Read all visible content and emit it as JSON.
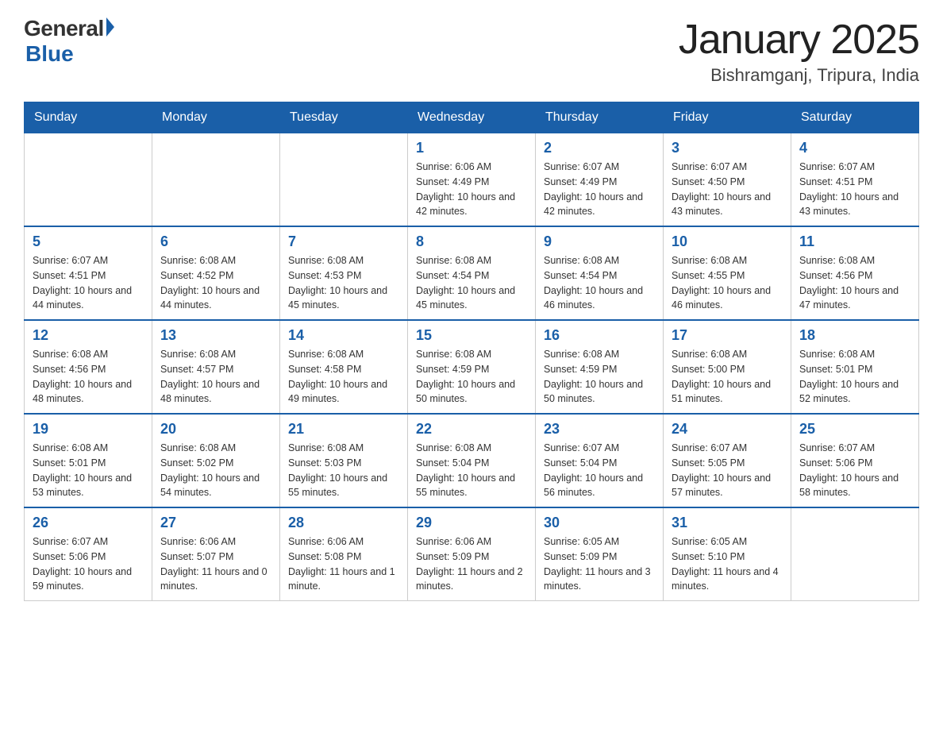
{
  "logo": {
    "general": "General",
    "blue": "Blue",
    "tagline": "Blue"
  },
  "title": {
    "month": "January 2025",
    "location": "Bishramganj, Tripura, India"
  },
  "days_of_week": [
    "Sunday",
    "Monday",
    "Tuesday",
    "Wednesday",
    "Thursday",
    "Friday",
    "Saturday"
  ],
  "weeks": [
    [
      {
        "day": "",
        "sunrise": "",
        "sunset": "",
        "daylight": ""
      },
      {
        "day": "",
        "sunrise": "",
        "sunset": "",
        "daylight": ""
      },
      {
        "day": "",
        "sunrise": "",
        "sunset": "",
        "daylight": ""
      },
      {
        "day": "1",
        "sunrise": "Sunrise: 6:06 AM",
        "sunset": "Sunset: 4:49 PM",
        "daylight": "Daylight: 10 hours and 42 minutes."
      },
      {
        "day": "2",
        "sunrise": "Sunrise: 6:07 AM",
        "sunset": "Sunset: 4:49 PM",
        "daylight": "Daylight: 10 hours and 42 minutes."
      },
      {
        "day": "3",
        "sunrise": "Sunrise: 6:07 AM",
        "sunset": "Sunset: 4:50 PM",
        "daylight": "Daylight: 10 hours and 43 minutes."
      },
      {
        "day": "4",
        "sunrise": "Sunrise: 6:07 AM",
        "sunset": "Sunset: 4:51 PM",
        "daylight": "Daylight: 10 hours and 43 minutes."
      }
    ],
    [
      {
        "day": "5",
        "sunrise": "Sunrise: 6:07 AM",
        "sunset": "Sunset: 4:51 PM",
        "daylight": "Daylight: 10 hours and 44 minutes."
      },
      {
        "day": "6",
        "sunrise": "Sunrise: 6:08 AM",
        "sunset": "Sunset: 4:52 PM",
        "daylight": "Daylight: 10 hours and 44 minutes."
      },
      {
        "day": "7",
        "sunrise": "Sunrise: 6:08 AM",
        "sunset": "Sunset: 4:53 PM",
        "daylight": "Daylight: 10 hours and 45 minutes."
      },
      {
        "day": "8",
        "sunrise": "Sunrise: 6:08 AM",
        "sunset": "Sunset: 4:54 PM",
        "daylight": "Daylight: 10 hours and 45 minutes."
      },
      {
        "day": "9",
        "sunrise": "Sunrise: 6:08 AM",
        "sunset": "Sunset: 4:54 PM",
        "daylight": "Daylight: 10 hours and 46 minutes."
      },
      {
        "day": "10",
        "sunrise": "Sunrise: 6:08 AM",
        "sunset": "Sunset: 4:55 PM",
        "daylight": "Daylight: 10 hours and 46 minutes."
      },
      {
        "day": "11",
        "sunrise": "Sunrise: 6:08 AM",
        "sunset": "Sunset: 4:56 PM",
        "daylight": "Daylight: 10 hours and 47 minutes."
      }
    ],
    [
      {
        "day": "12",
        "sunrise": "Sunrise: 6:08 AM",
        "sunset": "Sunset: 4:56 PM",
        "daylight": "Daylight: 10 hours and 48 minutes."
      },
      {
        "day": "13",
        "sunrise": "Sunrise: 6:08 AM",
        "sunset": "Sunset: 4:57 PM",
        "daylight": "Daylight: 10 hours and 48 minutes."
      },
      {
        "day": "14",
        "sunrise": "Sunrise: 6:08 AM",
        "sunset": "Sunset: 4:58 PM",
        "daylight": "Daylight: 10 hours and 49 minutes."
      },
      {
        "day": "15",
        "sunrise": "Sunrise: 6:08 AM",
        "sunset": "Sunset: 4:59 PM",
        "daylight": "Daylight: 10 hours and 50 minutes."
      },
      {
        "day": "16",
        "sunrise": "Sunrise: 6:08 AM",
        "sunset": "Sunset: 4:59 PM",
        "daylight": "Daylight: 10 hours and 50 minutes."
      },
      {
        "day": "17",
        "sunrise": "Sunrise: 6:08 AM",
        "sunset": "Sunset: 5:00 PM",
        "daylight": "Daylight: 10 hours and 51 minutes."
      },
      {
        "day": "18",
        "sunrise": "Sunrise: 6:08 AM",
        "sunset": "Sunset: 5:01 PM",
        "daylight": "Daylight: 10 hours and 52 minutes."
      }
    ],
    [
      {
        "day": "19",
        "sunrise": "Sunrise: 6:08 AM",
        "sunset": "Sunset: 5:01 PM",
        "daylight": "Daylight: 10 hours and 53 minutes."
      },
      {
        "day": "20",
        "sunrise": "Sunrise: 6:08 AM",
        "sunset": "Sunset: 5:02 PM",
        "daylight": "Daylight: 10 hours and 54 minutes."
      },
      {
        "day": "21",
        "sunrise": "Sunrise: 6:08 AM",
        "sunset": "Sunset: 5:03 PM",
        "daylight": "Daylight: 10 hours and 55 minutes."
      },
      {
        "day": "22",
        "sunrise": "Sunrise: 6:08 AM",
        "sunset": "Sunset: 5:04 PM",
        "daylight": "Daylight: 10 hours and 55 minutes."
      },
      {
        "day": "23",
        "sunrise": "Sunrise: 6:07 AM",
        "sunset": "Sunset: 5:04 PM",
        "daylight": "Daylight: 10 hours and 56 minutes."
      },
      {
        "day": "24",
        "sunrise": "Sunrise: 6:07 AM",
        "sunset": "Sunset: 5:05 PM",
        "daylight": "Daylight: 10 hours and 57 minutes."
      },
      {
        "day": "25",
        "sunrise": "Sunrise: 6:07 AM",
        "sunset": "Sunset: 5:06 PM",
        "daylight": "Daylight: 10 hours and 58 minutes."
      }
    ],
    [
      {
        "day": "26",
        "sunrise": "Sunrise: 6:07 AM",
        "sunset": "Sunset: 5:06 PM",
        "daylight": "Daylight: 10 hours and 59 minutes."
      },
      {
        "day": "27",
        "sunrise": "Sunrise: 6:06 AM",
        "sunset": "Sunset: 5:07 PM",
        "daylight": "Daylight: 11 hours and 0 minutes."
      },
      {
        "day": "28",
        "sunrise": "Sunrise: 6:06 AM",
        "sunset": "Sunset: 5:08 PM",
        "daylight": "Daylight: 11 hours and 1 minute."
      },
      {
        "day": "29",
        "sunrise": "Sunrise: 6:06 AM",
        "sunset": "Sunset: 5:09 PM",
        "daylight": "Daylight: 11 hours and 2 minutes."
      },
      {
        "day": "30",
        "sunrise": "Sunrise: 6:05 AM",
        "sunset": "Sunset: 5:09 PM",
        "daylight": "Daylight: 11 hours and 3 minutes."
      },
      {
        "day": "31",
        "sunrise": "Sunrise: 6:05 AM",
        "sunset": "Sunset: 5:10 PM",
        "daylight": "Daylight: 11 hours and 4 minutes."
      },
      {
        "day": "",
        "sunrise": "",
        "sunset": "",
        "daylight": ""
      }
    ]
  ]
}
